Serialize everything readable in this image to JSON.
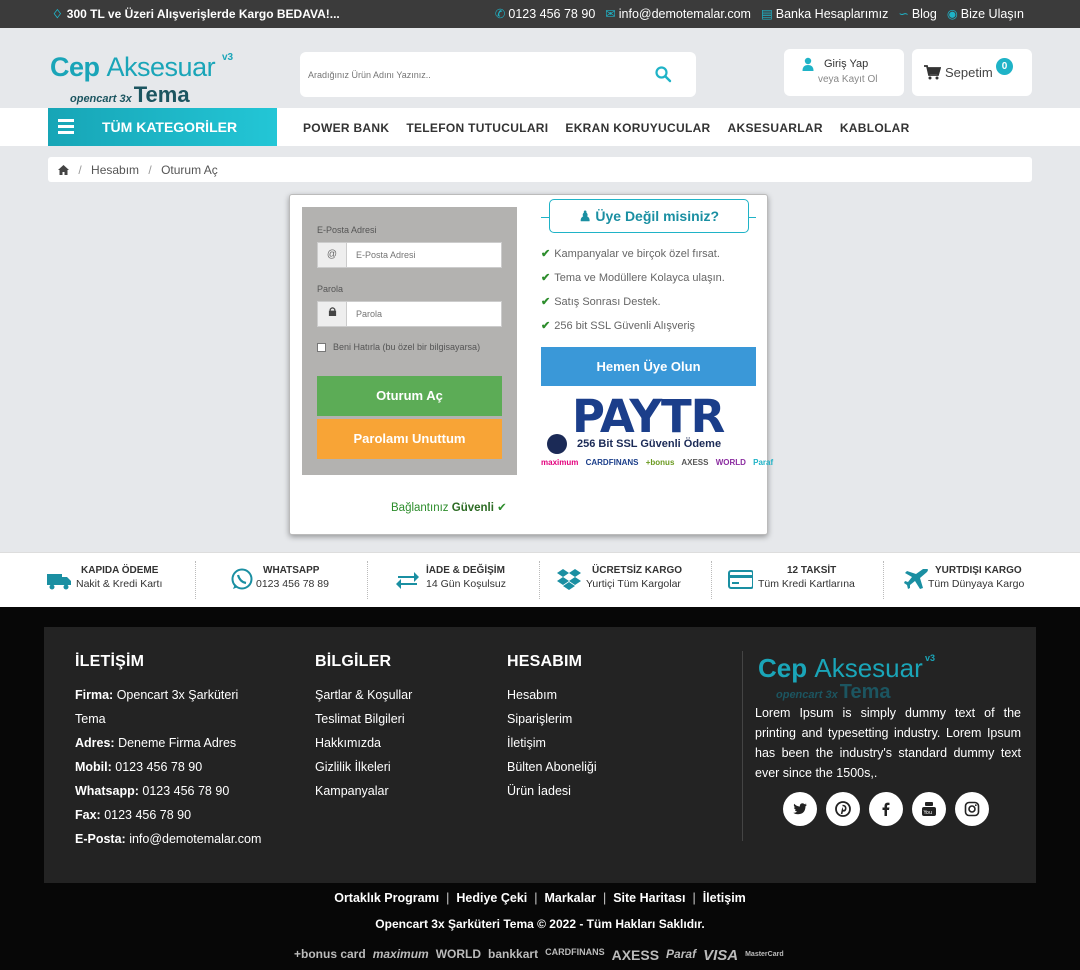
{
  "topbar": {
    "promo": "300 TL ve Üzeri Alışverişlerde Kargo BEDAVA!...",
    "phone": "0123 456 78 90",
    "email": "info@demotemalar.com",
    "bank": "Banka Hesaplarımız",
    "blog": "Blog",
    "contact": "Bize Ulaşın"
  },
  "logo": {
    "brand_a": "Cep",
    "brand_b": "Aksesuar",
    "version": "v3",
    "sub": "opencart 3x",
    "tema": "Tema"
  },
  "search": {
    "placeholder": "Aradığınız Ürün Adını Yazınız.."
  },
  "account": {
    "login": "Giriş Yap",
    "register": "veya Kayıt Ol"
  },
  "cart": {
    "label": "Sepetim",
    "count": "0"
  },
  "nav": {
    "all_categories": "TÜM KATEGORİLER",
    "items": [
      "POWER BANK",
      "TELEFON TUTUCULARI",
      "EKRAN KORUYUCULAR",
      "AKSESUARLAR",
      "KABLOLAR"
    ]
  },
  "breadcrumb": {
    "items": [
      "Hesabım",
      "Oturum Aç"
    ]
  },
  "login_form": {
    "email_label": "E-Posta Adresi",
    "email_placeholder": "E-Posta Adresi",
    "email_addon": "@",
    "password_label": "Parola",
    "password_placeholder": "Parola",
    "remember": "Beni Hatırla (bu özel bir bilgisayarsa)",
    "login_button": "Oturum Aç",
    "forgot_button": "Parolamı Unuttum",
    "secure_prefix": "Bağlantınız",
    "secure_word": "Güvenli"
  },
  "not_member": {
    "title": "Üye Değil misiniz?",
    "benefits": [
      "Kampanyalar ve birçok özel fırsat.",
      "Tema ve Modüllere Kolayca ulaşın.",
      "Satış Sonrası Destek.",
      "256 bit SSL Güvenli Alışveriş"
    ],
    "register_button": "Hemen Üye Olun",
    "paytr_logo": "PAYTR",
    "paytr_sub": "256 Bit SSL Güvenli Ödeme",
    "paytr_banks": [
      "maximum",
      "CARDFINANS",
      "+bonus",
      "AXESS",
      "WORLD",
      "Paraf"
    ]
  },
  "features": [
    {
      "title": "KAPIDA ÖDEME",
      "sub": "Nakit & Kredi Kartı",
      "icon": "truck-icon"
    },
    {
      "title": "WHATSAPP",
      "sub": "0123 456 78 89",
      "icon": "whatsapp-icon"
    },
    {
      "title": "İADE & DEĞİŞİM",
      "sub": "14 Gün Koşulsuz",
      "icon": "exchange-icon"
    },
    {
      "title": "ÜCRETSİZ KARGO",
      "sub": "Yurtiçi Tüm Kargolar",
      "icon": "dropbox-icon"
    },
    {
      "title": "12 TAKSİT",
      "sub": "Tüm Kredi Kartlarına",
      "icon": "credit-card-icon"
    },
    {
      "title": "YURTDIŞI KARGO",
      "sub": "Tüm Dünyaya Kargo",
      "icon": "plane-icon"
    }
  ],
  "footer": {
    "contact": {
      "title": "İLETİŞİM",
      "firma_label": "Firma:",
      "firma": "Opencart 3x Şarküteri",
      "firma2": "Tema",
      "adres_label": "Adres:",
      "adres": "Deneme Firma Adres",
      "mobil_label": "Mobil:",
      "mobil": "0123 456 78 90",
      "whatsapp_label": "Whatsapp:",
      "whatsapp": "0123 456 78 90",
      "fax_label": "Fax:",
      "fax": "0123 456 78 90",
      "eposta_label": "E-Posta:",
      "eposta": "info@demotemalar.com"
    },
    "info": {
      "title": "BİLGİLER",
      "links": [
        "Şartlar & Koşullar",
        "Teslimat Bilgileri",
        "Hakkımızda",
        "Gizlilik İlkeleri",
        "Kampanyalar"
      ]
    },
    "account": {
      "title": "HESABIM",
      "links": [
        "Hesabım",
        "Siparişlerim",
        "İletişim",
        "Bülten Aboneliği",
        "Ürün İadesi"
      ]
    },
    "about": "Lorem Ipsum is simply dummy text of the printing and typesetting industry. Lorem Ipsum has been the industry's standard dummy text ever since the 1500s,.",
    "social": [
      "twitter-icon",
      "pinterest-icon",
      "facebook-icon",
      "youtube-icon",
      "instagram-icon"
    ],
    "bottom_links": [
      "Ortaklık Programı",
      "Hediye Çeki",
      "Markalar",
      "Site Haritası",
      "İletişim"
    ],
    "copyright": "Opencart 3x Şarküteri Tema © 2022 - Tüm Hakları Saklıdır.",
    "payments": [
      "+bonus card",
      "maximum",
      "WORLD",
      "bankkart",
      "CARDFINANS",
      "AXESS",
      "Paraf",
      "VISA",
      "MasterCard"
    ]
  },
  "colors": {
    "accent": "#1fb3c7",
    "login_green": "#5cac56",
    "forgot_orange": "#f8a436",
    "register_blue": "#3a98d8"
  }
}
